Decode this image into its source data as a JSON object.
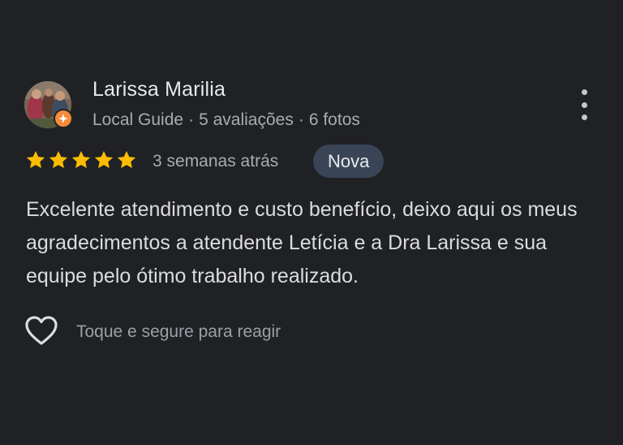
{
  "review": {
    "author": {
      "name": "Larissa Marilia",
      "badge": "Local Guide",
      "reviews_count": "5 avaliações",
      "photos_count": "6 fotos",
      "separator": "·",
      "badge_icon": "local-guide-star-icon",
      "badge_color": "#f58a3b"
    },
    "rating": 5,
    "rating_max": 5,
    "star_color": "#fbbc04",
    "time_ago": "3 semanas atrás",
    "tag": "Nova",
    "text": "Excelente atendimento e custo benefício, deixo aqui os meus agradecimentos a atendente Letícia e a Dra Larissa e sua equipe pelo ótimo trabalho realizado.",
    "reaction": {
      "icon": "heart-outline-icon",
      "label": "Toque e segure para reagir"
    },
    "menu_icon": "more-vertical-icon"
  }
}
